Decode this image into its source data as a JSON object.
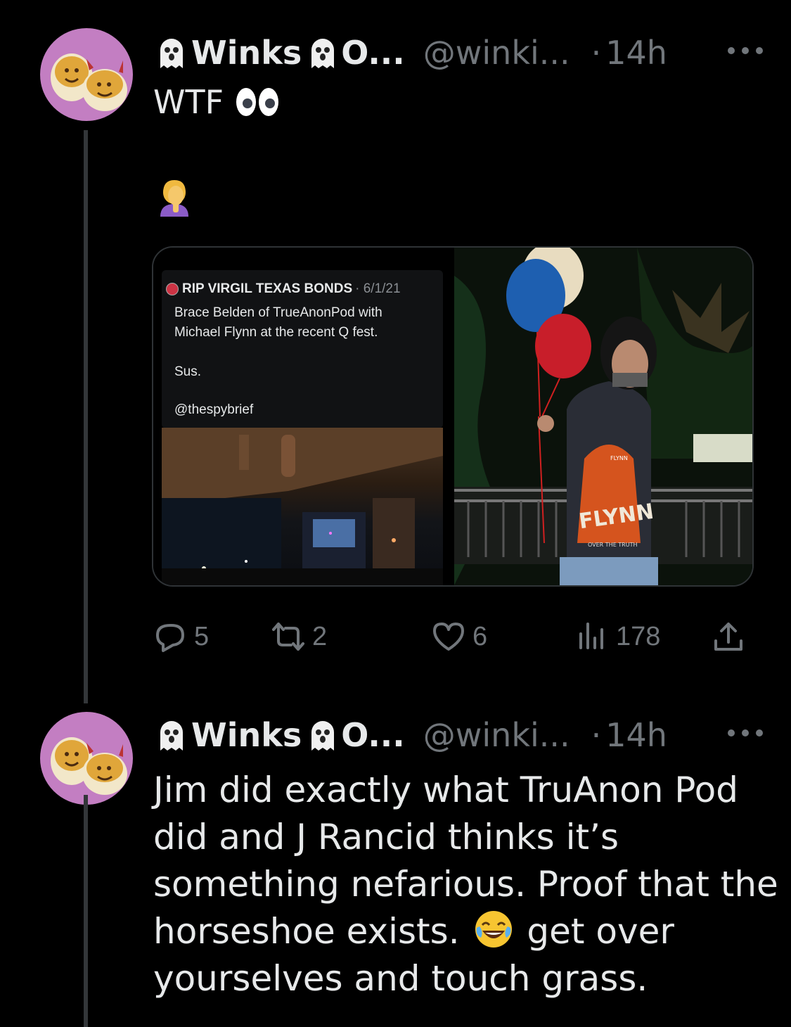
{
  "tweets": [
    {
      "author": {
        "display_name": "Winks",
        "suffix": "O...",
        "handle": "@winki...",
        "time": "14h"
      },
      "text_lines": [
        "WTF"
      ],
      "media": {
        "embedded_post": {
          "author": "RIP VIRGIL TEXAS BONDS",
          "date": "· 6/1/21",
          "lines": [
            "Brace Belden of TrueAnonPod with",
            "Michael Flynn at the recent Q fest.",
            "",
            "Sus.",
            "",
            "@thespybrief"
          ]
        },
        "photo_text": {
          "jacket": "FLYNN",
          "tag": "FLYNN",
          "slogan": "OVER THE TRUTH"
        }
      },
      "actions": {
        "replies": "5",
        "reposts": "2",
        "likes": "6",
        "views": "178"
      }
    },
    {
      "author": {
        "display_name": "Winks",
        "suffix": "O...",
        "handle": "@winki...",
        "time": "14h"
      },
      "text_lines": [
        "Jim did exactly what TruAnon Pod",
        "did and J Rancid thinks it’s",
        "something nefarious. Proof that the",
        "horseshoe exists.",
        "get over",
        "yourselves and touch grass."
      ]
    }
  ],
  "icons": [
    "ghost-icon",
    "eyes-emoji",
    "facepalm-emoji",
    "reply-icon",
    "repost-icon",
    "like-icon",
    "views-icon",
    "share-icon",
    "more-icon",
    "laughing-emoji"
  ],
  "colors": {
    "background": "#000000",
    "text": "#e7e9ea",
    "secondary": "#71767b",
    "avatar": "#c37ec2"
  }
}
